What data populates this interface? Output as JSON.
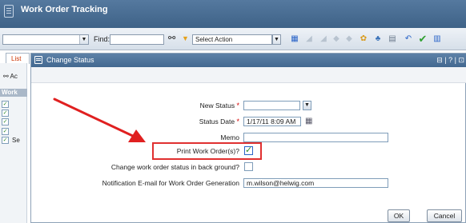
{
  "app": {
    "title": "Work Order Tracking"
  },
  "toolbar": {
    "find_label": "Find:",
    "find_value": "",
    "action_select": "Select Action",
    "icons": [
      "binoculars-icon",
      "filter-icon",
      "calendar-icon",
      "save-icon",
      "clear-icon",
      "prev-icon",
      "next-icon",
      "workflow-icon",
      "people-icon",
      "report-icon",
      "back-icon",
      "approve-icon",
      "chart-icon"
    ]
  },
  "background": {
    "tab_label": "List",
    "ac_label": "Ac",
    "work_label": "Work",
    "se_label": "Se"
  },
  "dialog": {
    "title": "Change Status",
    "controls": "⊟ | ? | ⊡",
    "fields": {
      "new_status": {
        "label": "New Status",
        "value": ""
      },
      "status_date": {
        "label": "Status Date",
        "value": "1/17/11 8:09 AM"
      },
      "memo": {
        "label": "Memo",
        "value": ""
      },
      "print_work_orders": {
        "label": "Print Work Order(s)?",
        "checked": true
      },
      "change_background": {
        "label": "Change work order status in back ground?",
        "checked": false
      },
      "notification_email": {
        "label": "Notification E-mail for Work Order Generation",
        "value": "m.wilson@helwig.com"
      }
    },
    "buttons": {
      "ok": "OK",
      "cancel": "Cancel"
    }
  },
  "colors": {
    "highlight": "#e03030",
    "arrow": "#e02020",
    "required": "#d40000"
  }
}
